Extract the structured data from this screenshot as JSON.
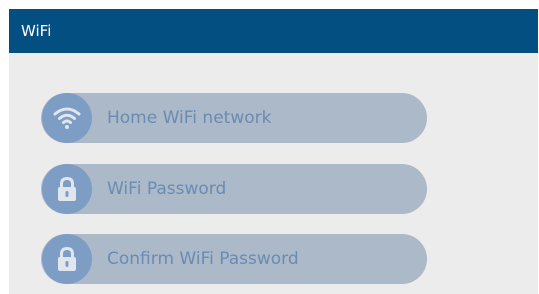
{
  "header": {
    "title": "WiFi"
  },
  "form": {
    "network_placeholder": "Home WiFi network",
    "password_placeholder": "WiFi Password",
    "confirm_placeholder": "Confirm WiFi Password"
  },
  "icons": {
    "network": "wifi-icon",
    "password": "lock-icon",
    "confirm": "lock-icon"
  },
  "colors": {
    "header_bg": "#044f82",
    "content_bg": "#ececed",
    "field_bg": "#abb9c8",
    "icon_circle": "#7e9dc4",
    "field_text": "#6a8bb3"
  }
}
